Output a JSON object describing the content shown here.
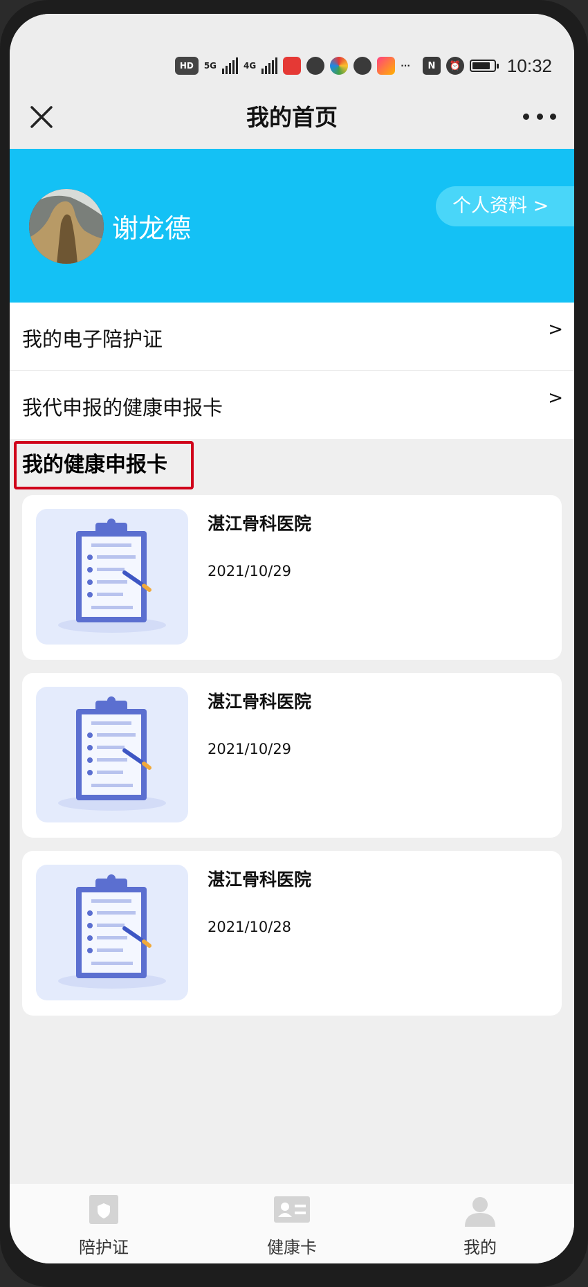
{
  "status_bar": {
    "hd": "HD",
    "sim1": "5G",
    "sim2": "4G",
    "more": "···",
    "battery_level": 0.85,
    "time": "10:32"
  },
  "header": {
    "title": "我的首页"
  },
  "profile": {
    "name": "谢龙德",
    "profile_button": "个人资料 >"
  },
  "menu": [
    {
      "label": "我的电子陪护证",
      "arrow": ">"
    },
    {
      "label": "我代申报的健康申报卡",
      "arrow": ">"
    }
  ],
  "section": {
    "title": "我的健康申报卡"
  },
  "cards": [
    {
      "hospital": "湛江骨科医院",
      "date": "2021/10/29"
    },
    {
      "hospital": "湛江骨科医院",
      "date": "2021/10/29"
    },
    {
      "hospital": "湛江骨科医院",
      "date": "2021/10/28"
    }
  ],
  "tabbar": [
    {
      "label": "陪护证",
      "icon": "shield-card-icon"
    },
    {
      "label": "健康卡",
      "icon": "id-card-icon"
    },
    {
      "label": "我的",
      "icon": "person-icon"
    }
  ],
  "colors": {
    "banner": "#14c1f5",
    "profile_button": "#49d6f9",
    "highlight_border": "#d0021b",
    "thumb_bg": "#e4ebfc",
    "clipboard": "#5b6fd0"
  }
}
